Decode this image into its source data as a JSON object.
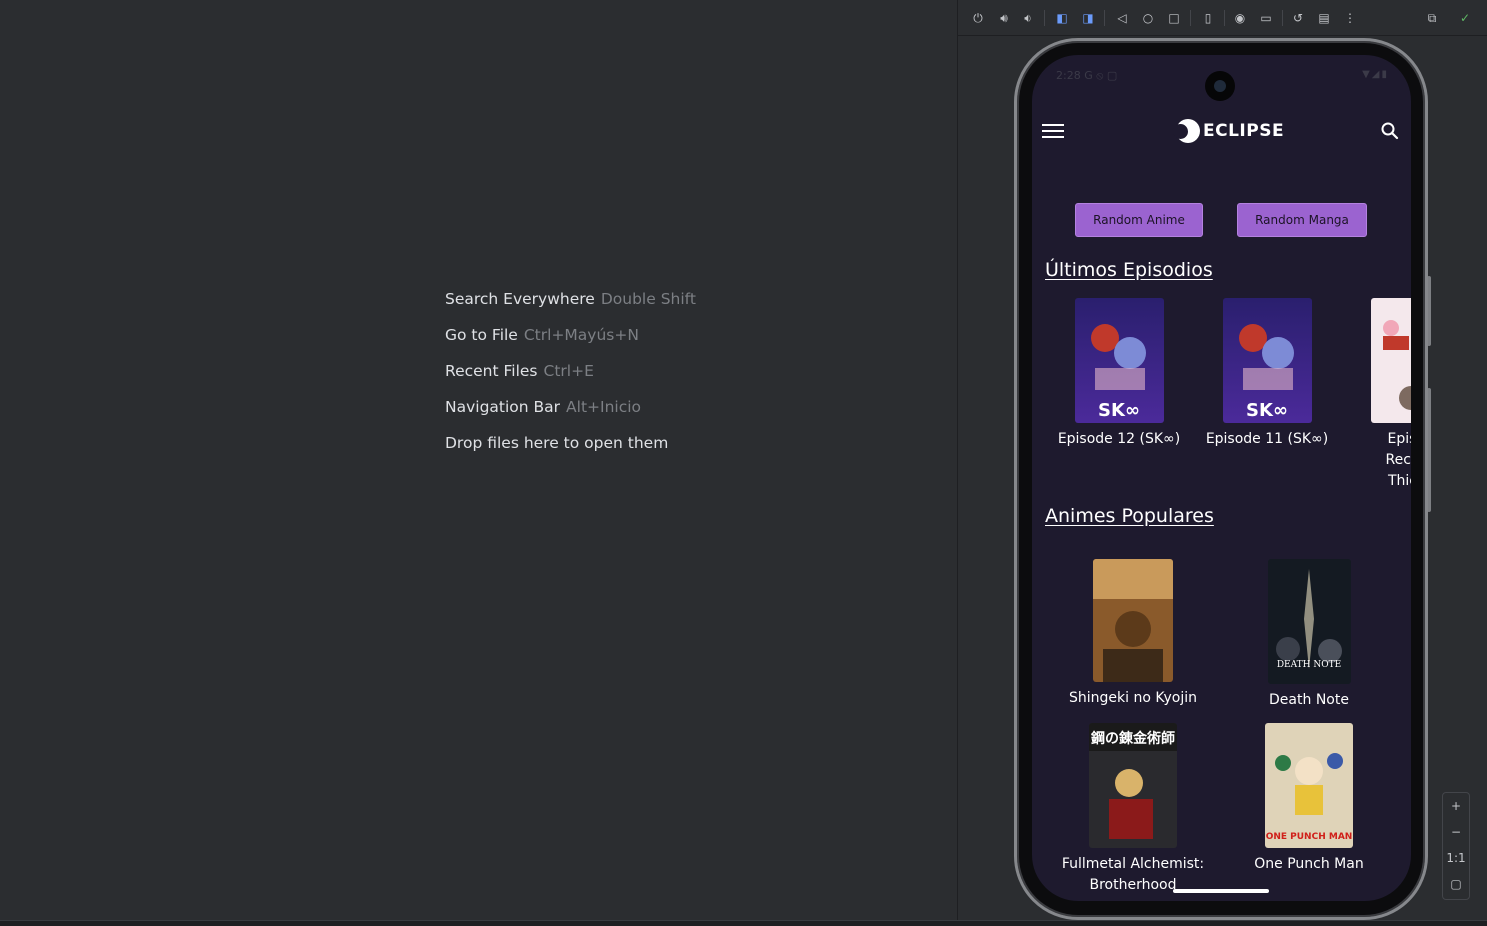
{
  "editor": {
    "hints": [
      {
        "label": "Search Everywhere",
        "shortcut": "Double Shift"
      },
      {
        "label": "Go to File",
        "shortcut": "Ctrl+Mayús+N"
      },
      {
        "label": "Recent Files",
        "shortcut": "Ctrl+E"
      },
      {
        "label": "Navigation Bar",
        "shortcut": "Alt+Inicio"
      },
      {
        "label": "Drop files here to open them",
        "shortcut": ""
      }
    ]
  },
  "emulator": {
    "toolbar": {
      "icons": [
        "power-icon",
        "volume-up-icon",
        "volume-down-icon",
        "rotate-left-icon",
        "rotate-right-icon",
        "back-icon",
        "home-icon",
        "overview-icon",
        "fold-icon",
        "screenshot-icon",
        "record-icon",
        "snapshot-icon",
        "extended-controls-icon",
        "more-icon",
        "device-mirror-icon",
        "check-icon"
      ]
    },
    "zoom": {
      "in": "+",
      "out": "−",
      "reset": "1:1",
      "fit": "▢"
    }
  },
  "app": {
    "status_time": "2:28",
    "status_icons": "G ⦸ ▢",
    "status_right": "▼◢▮",
    "brand": "ECLIPSE",
    "buttons": {
      "random_anime": "Random Anime",
      "random_manga": "Random Manga"
    },
    "latest_title": "Últimos Episodios",
    "latest": [
      {
        "label": "Episode 12 (SK∞)",
        "poster": "SK∞"
      },
      {
        "label": "Episode 11 (SK∞)",
        "poster": "SK∞"
      },
      {
        "label": "Episode\nRecoil: F\nThieves",
        "poster": ""
      }
    ],
    "popular_title": "Animes Populares",
    "popular": [
      {
        "label": "Shingeki no Kyojin",
        "poster": ""
      },
      {
        "label": "Death Note",
        "poster": "DEATH NOTE"
      },
      {
        "label": "Fullmetal Alchemist: Brotherhood",
        "poster": "鋼の錬金術師"
      },
      {
        "label": "One Punch Man",
        "poster": "ONE PUNCH MAN"
      }
    ],
    "colors": {
      "background": "#1e1a2e",
      "button": "#9b63d0",
      "text": "#ffffff"
    }
  }
}
